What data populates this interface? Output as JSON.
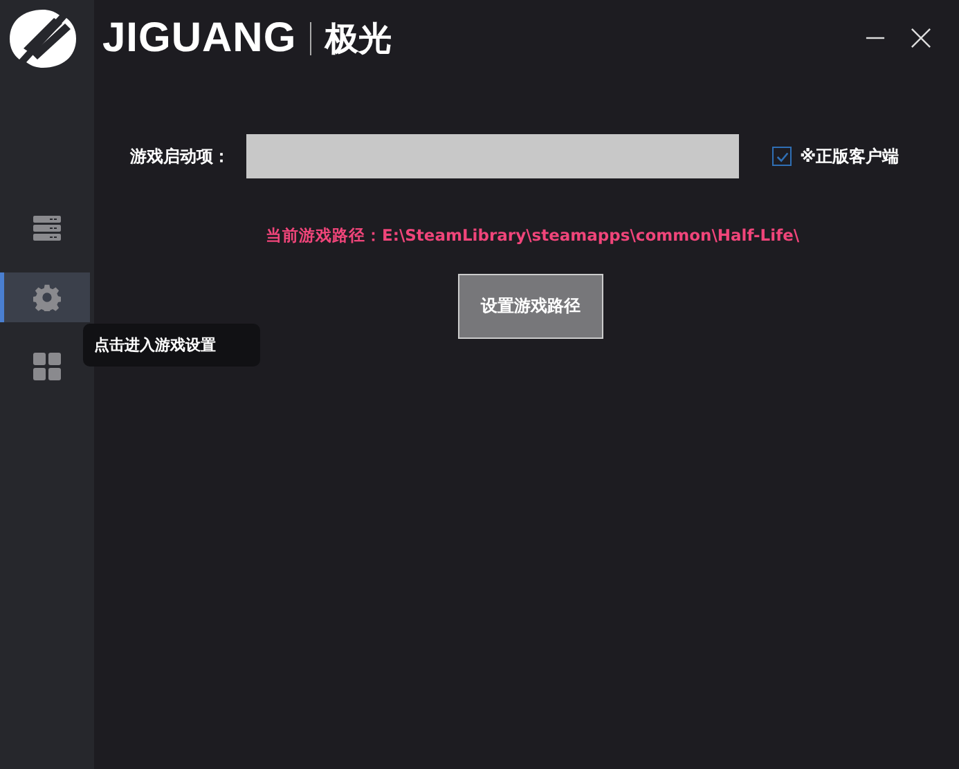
{
  "window": {
    "brand": "JIGUANG",
    "brand_cn": "极光",
    "controls": [
      {
        "kind": "minimize"
      },
      {
        "kind": "close"
      }
    ]
  },
  "sidebar": {
    "items": [
      {
        "kind": "server",
        "selected": false
      },
      {
        "kind": "gear",
        "selected": true,
        "tooltip": "点击进入游戏设置"
      },
      {
        "kind": "grid",
        "selected": false
      }
    ]
  },
  "launch_options": {
    "label": "游戏启动项：",
    "client": {
      "label": "※正版客户端",
      "checked": true
    }
  },
  "game_path": "当前游戏路径：E:\\SteamLibrary\\steamapps\\common\\Half-Life\\",
  "set_path_button": "设置游戏路径"
}
